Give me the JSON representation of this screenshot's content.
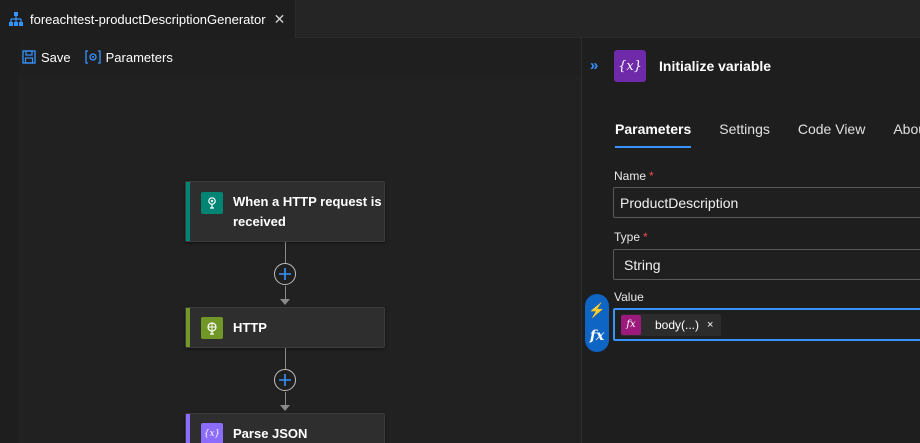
{
  "tab": {
    "title": "foreachtest-productDescriptionGenerator",
    "close_glyph": "✕",
    "icon": "logic-app-icon"
  },
  "toolbar": {
    "save_label": "Save",
    "parameters_label": "Parameters"
  },
  "canvas": {
    "cards": [
      {
        "title": "When a HTTP request is received",
        "icon": "http-request-trigger-icon",
        "color": "#008575"
      },
      {
        "title": "HTTP",
        "icon": "http-globe-icon",
        "color": "#709727"
      },
      {
        "title": "Parse JSON",
        "icon": "variable-icon",
        "color": "#8c6cff"
      }
    ],
    "add_step_icon": "plus-icon"
  },
  "panel": {
    "collapse_glyph": "»",
    "icon_glyph": "{x}",
    "title": "Initialize variable",
    "tabs": [
      "Parameters",
      "Settings",
      "Code View",
      "About"
    ],
    "active_tab": "Parameters",
    "fields": {
      "name_label": "Name",
      "name_value": "ProductDescription",
      "type_label": "Type",
      "type_value": "String",
      "value_label": "Value",
      "required_marker": "*"
    },
    "token": {
      "glyph": "fx",
      "label": "body(...)",
      "remove_glyph": "×"
    },
    "side_buttons": {
      "dynamic_content_glyph": "⚡",
      "expression_glyph": "fx"
    }
  },
  "colors": {
    "accent": "#3794ff",
    "required": "#f14c4c",
    "variable_purple": "#6e2aa8",
    "expression_magenta": "#9b1a7c"
  }
}
